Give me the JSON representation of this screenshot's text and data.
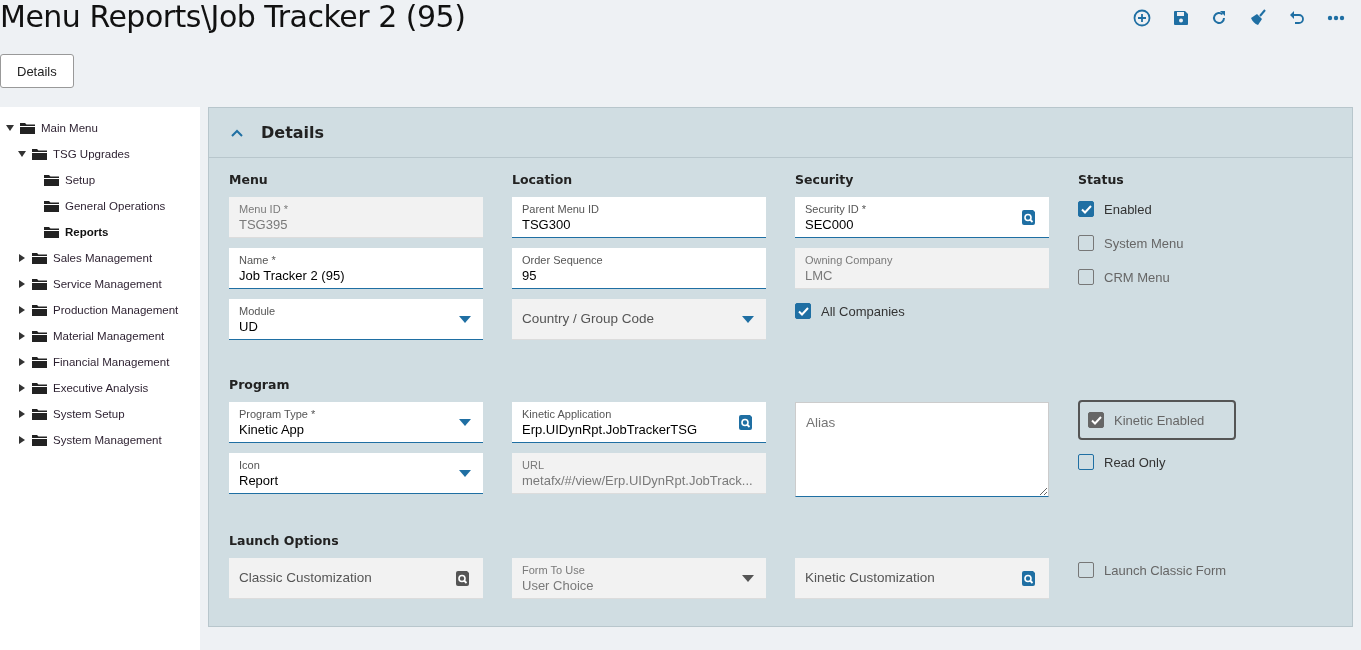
{
  "page": {
    "title": "Menu Reports\\Job Tracker 2 (95)",
    "toolbar": [
      {
        "kind": "add"
      },
      {
        "kind": "save"
      },
      {
        "kind": "refresh"
      },
      {
        "kind": "clear"
      },
      {
        "kind": "undo"
      },
      {
        "kind": "more"
      }
    ],
    "tab_button": "Details"
  },
  "tree": [
    {
      "label": "Main Menu",
      "expandable": true,
      "expanded": true,
      "selected": false,
      "children": [
        {
          "label": "TSG Upgrades",
          "expandable": true,
          "expanded": true,
          "selected": false,
          "children": [
            {
              "label": "Setup",
              "expandable": false,
              "expanded": false,
              "selected": false
            },
            {
              "label": "General Operations",
              "expandable": false,
              "expanded": false,
              "selected": false
            },
            {
              "label": "Reports",
              "expandable": false,
              "expanded": false,
              "selected": true
            }
          ]
        },
        {
          "label": "Sales Management",
          "expandable": true,
          "expanded": false,
          "selected": false
        },
        {
          "label": "Service Management",
          "expandable": true,
          "expanded": false,
          "selected": false
        },
        {
          "label": "Production Management",
          "expandable": true,
          "expanded": false,
          "selected": false
        },
        {
          "label": "Material Management",
          "expandable": true,
          "expanded": false,
          "selected": false
        },
        {
          "label": "Financial Management",
          "expandable": true,
          "expanded": false,
          "selected": false
        },
        {
          "label": "Executive Analysis",
          "expandable": true,
          "expanded": false,
          "selected": false
        },
        {
          "label": "System Setup",
          "expandable": true,
          "expanded": false,
          "selected": false
        },
        {
          "label": "System Management",
          "expandable": true,
          "expanded": false,
          "selected": false
        }
      ]
    }
  ],
  "panel": {
    "title": "Details",
    "expanded": true,
    "sections": [
      {
        "columns": [
          {
            "heading": "Menu",
            "controls": [
              {
                "kind": "text",
                "label": "Menu ID *",
                "value": "TSG395",
                "disabled": true
              },
              {
                "kind": "text",
                "label": "Name *",
                "value": "Job Tracker 2 (95)",
                "disabled": false
              },
              {
                "kind": "select",
                "label": "Module",
                "value": "UD",
                "disabled": false
              }
            ]
          },
          {
            "heading": "Location",
            "controls": [
              {
                "kind": "text",
                "label": "Parent Menu ID",
                "value": "TSG300",
                "disabled": false
              },
              {
                "kind": "text",
                "label": "Order Sequence",
                "value": "95",
                "disabled": false
              },
              {
                "kind": "select",
                "placeholder": "Country / Group Code",
                "disabled": false
              }
            ]
          },
          {
            "heading": "Security",
            "controls": [
              {
                "kind": "lookup",
                "label": "Security ID *",
                "value": "SEC000",
                "disabled": false
              },
              {
                "kind": "text",
                "label": "Owning Company",
                "value": "LMC",
                "disabled": true
              },
              {
                "kind": "checkbox",
                "label": "All Companies",
                "checked": true,
                "disabled": false,
                "focused": false
              }
            ]
          },
          {
            "heading": "Status",
            "controls": [
              {
                "kind": "checkbox",
                "label": "Enabled",
                "checked": true,
                "disabled": false,
                "focused": false
              },
              {
                "kind": "checkbox",
                "label": "System Menu",
                "checked": false,
                "disabled": true,
                "focused": false
              },
              {
                "kind": "checkbox",
                "label": "CRM Menu",
                "checked": false,
                "disabled": true,
                "focused": false
              }
            ]
          }
        ]
      },
      {
        "heading": "Program",
        "columns": [
          {
            "controls": [
              {
                "kind": "select",
                "label": "Program Type *",
                "value": "Kinetic App",
                "disabled": false
              },
              {
                "kind": "select",
                "label": "Icon",
                "value": "Report",
                "disabled": false
              }
            ]
          },
          {
            "controls": [
              {
                "kind": "lookup",
                "label": "Kinetic Application",
                "value": "Erp.UIDynRpt.JobTrackerTSG",
                "disabled": false
              },
              {
                "kind": "text",
                "label": "URL",
                "value": "metafx/#/view/Erp.UIDynRpt.JobTrack...",
                "disabled": true
              }
            ]
          },
          {
            "controls": [
              {
                "kind": "textarea",
                "placeholder": "Alias",
                "disabled": false
              }
            ]
          },
          {
            "controls": [
              {
                "kind": "checkbox",
                "label": "Kinetic Enabled",
                "checked": true,
                "disabled": true,
                "focused": true
              },
              {
                "kind": "checkbox",
                "label": "Read Only",
                "checked": false,
                "disabled": false,
                "focused": false
              }
            ]
          }
        ]
      },
      {
        "heading": "Launch Options",
        "columns": [
          {
            "controls": [
              {
                "kind": "lookup",
                "placeholder": "Classic Customization",
                "disabled": true
              }
            ]
          },
          {
            "controls": [
              {
                "kind": "select",
                "label": "Form To Use",
                "value": "User Choice",
                "disabled": true
              }
            ]
          },
          {
            "controls": [
              {
                "kind": "lookup",
                "placeholder": "Kinetic Customization",
                "disabled": false
              }
            ]
          },
          {
            "controls": [
              {
                "kind": "checkbox",
                "label": "Launch Classic Form",
                "checked": false,
                "disabled": true,
                "focused": false
              }
            ]
          }
        ]
      }
    ]
  }
}
